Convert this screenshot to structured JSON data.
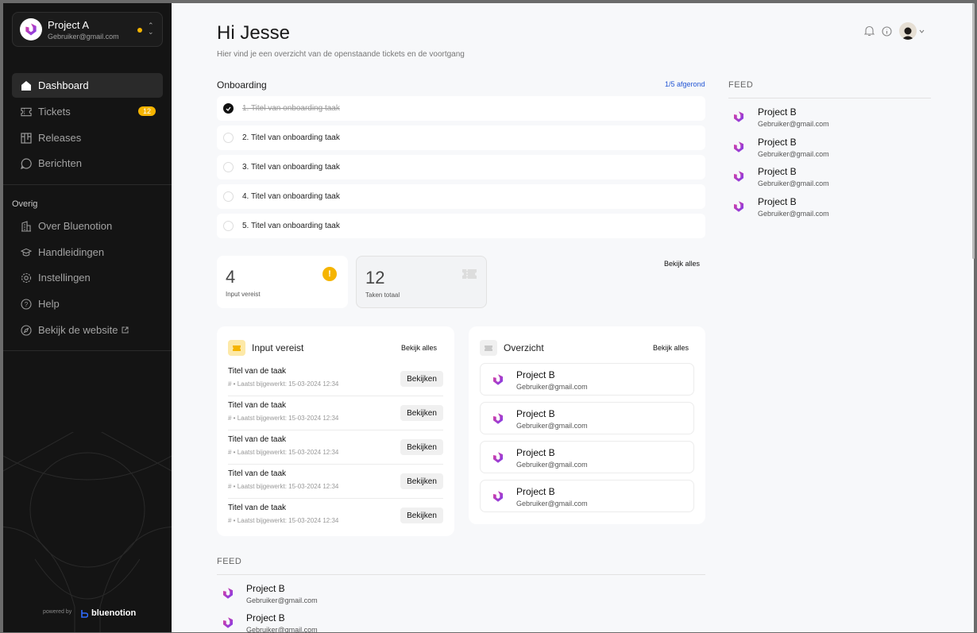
{
  "sidebar": {
    "project": {
      "name": "Project A",
      "email": "Gebruiker@gmail.com"
    },
    "nav": [
      {
        "label": "Dashboard",
        "icon": "home-icon",
        "active": true
      },
      {
        "label": "Tickets",
        "icon": "ticket-icon",
        "badge": "12"
      },
      {
        "label": "Releases",
        "icon": "releases-icon"
      },
      {
        "label": "Berichten",
        "icon": "message-icon"
      }
    ],
    "section_title": "Overig",
    "nav2": [
      {
        "label": "Over Bluenotion",
        "icon": "building-icon"
      },
      {
        "label": "Handleidingen",
        "icon": "graduation-cap-icon"
      },
      {
        "label": "Instellingen",
        "icon": "gear-icon"
      },
      {
        "label": "Help",
        "icon": "help-icon"
      },
      {
        "label": "Bekijk de website",
        "icon": "compass-icon"
      }
    ],
    "powered_by": "powered by",
    "brand": "bluenotion"
  },
  "header": {
    "greeting": "Hi Jesse",
    "subtitle": "Hier vind je een overzicht van de openstaande tickets en de voortgang"
  },
  "onboarding": {
    "title": "Onboarding",
    "progress": "1/5 afgerond",
    "tasks": [
      {
        "label": "1. Titel van onboarding taak",
        "done": true
      },
      {
        "label": "2. Titel van onboarding taak",
        "done": false
      },
      {
        "label": "3. Titel van onboarding taak",
        "done": false
      },
      {
        "label": "4. Titel van onboarding taak",
        "done": false
      },
      {
        "label": "5. Titel van onboarding taak",
        "done": false
      }
    ]
  },
  "stats": {
    "input": {
      "value": "4",
      "label": "Input vereist"
    },
    "tasks": {
      "value": "12",
      "label": "Taken totaal"
    },
    "view_all": "Bekijk alles"
  },
  "input_card": {
    "title": "Input vereist",
    "view_all": "Bekijk alles",
    "rows": [
      {
        "title": "Titel van de taak",
        "meta": "# •  Laatst bijgewerkt: 15-03-2024 12:34",
        "button": "Bekijken"
      },
      {
        "title": "Titel van de taak",
        "meta": "# •  Laatst bijgewerkt: 15-03-2024 12:34",
        "button": "Bekijken"
      },
      {
        "title": "Titel van de taak",
        "meta": "# •  Laatst bijgewerkt: 15-03-2024 12:34",
        "button": "Bekijken"
      },
      {
        "title": "Titel van de taak",
        "meta": "# •  Laatst bijgewerkt: 15-03-2024 12:34",
        "button": "Bekijken"
      },
      {
        "title": "Titel van de taak",
        "meta": "# •  Laatst bijgewerkt: 15-03-2024 12:34",
        "button": "Bekijken"
      }
    ]
  },
  "overview_card": {
    "title": "Overzicht",
    "view_all": "Bekijk alles",
    "projects": [
      {
        "name": "Project B",
        "email": "Gebruiker@gmail.com"
      },
      {
        "name": "Project B",
        "email": "Gebruiker@gmail.com"
      },
      {
        "name": "Project B",
        "email": "Gebruiker@gmail.com"
      },
      {
        "name": "Project B",
        "email": "Gebruiker@gmail.com"
      }
    ]
  },
  "feed_right": {
    "title": "FEED",
    "items": [
      {
        "name": "Project B",
        "email": "Gebruiker@gmail.com"
      },
      {
        "name": "Project B",
        "email": "Gebruiker@gmail.com"
      },
      {
        "name": "Project B",
        "email": "Gebruiker@gmail.com"
      },
      {
        "name": "Project B",
        "email": "Gebruiker@gmail.com"
      }
    ]
  },
  "feed_bottom": {
    "title": "FEED",
    "items": [
      {
        "name": "Project B",
        "email": "Gebruiker@gmail.com"
      },
      {
        "name": "Project B",
        "email": "Gebruiker@gmail.com"
      }
    ]
  },
  "colors": {
    "accent": "#f5b400",
    "link": "#2255d4",
    "logo_purple": "#7a3cf0",
    "logo_pink": "#e0409a"
  }
}
